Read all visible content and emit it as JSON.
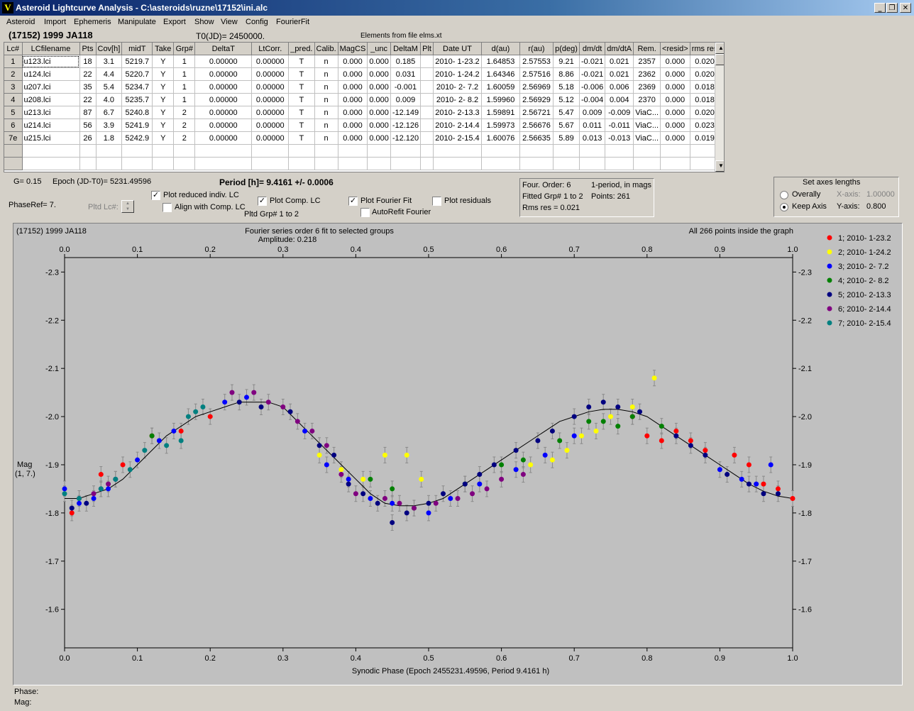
{
  "window": {
    "title": "Asteroid Lightcurve Analysis - C:\\asteroids\\ruzne\\17152\\ini.alc",
    "min": "_",
    "restore": "❐",
    "close": "✕"
  },
  "menu": [
    "Asteroid",
    "Import",
    "Ephemeris",
    "Manipulate",
    "Export",
    "Show",
    "View",
    "Config",
    "FourierFit"
  ],
  "header": {
    "object": "(17152) 1999 JA118",
    "t0": "T0(JD)= 2450000.",
    "elements": "Elements from file elms.xt"
  },
  "table": {
    "columns": [
      "Lc#",
      "LCfilename",
      "Pts",
      "Cov[h]",
      "midT",
      "Take",
      "Grp#",
      "DeltaT",
      "LtCorr.",
      "_pred.",
      "Calib.",
      "MagCS",
      "_unc",
      "DeltaM",
      "Plt",
      "Date UT",
      "d(au)",
      "r(au)",
      "p(deg)",
      "dm/dt",
      "dm/dtA",
      "Rem.",
      "<resid>",
      "rms res"
    ],
    "rows": [
      [
        "1",
        "u123.lci",
        "18",
        "3.1",
        "5219.7",
        "Y",
        "1",
        "0.00000",
        "0.00000",
        "T",
        "n",
        "0.000",
        "0.000",
        "0.185",
        "",
        "2010- 1-23.2",
        "1.64853",
        "2.57553",
        "9.21",
        "-0.021",
        "0.021",
        "2357",
        "0.000",
        "0.020"
      ],
      [
        "2",
        "u124.lci",
        "22",
        "4.4",
        "5220.7",
        "Y",
        "1",
        "0.00000",
        "0.00000",
        "T",
        "n",
        "0.000",
        "0.000",
        "0.031",
        "",
        "2010- 1-24.2",
        "1.64346",
        "2.57516",
        "8.86",
        "-0.021",
        "0.021",
        "2362",
        "0.000",
        "0.020"
      ],
      [
        "3",
        "u207.lci",
        "35",
        "5.4",
        "5234.7",
        "Y",
        "1",
        "0.00000",
        "0.00000",
        "T",
        "n",
        "0.000",
        "0.000",
        "-0.001",
        "",
        "2010- 2- 7.2",
        "1.60059",
        "2.56969",
        "5.18",
        "-0.006",
        "0.006",
        "2369",
        "0.000",
        "0.018"
      ],
      [
        "4",
        "u208.lci",
        "22",
        "4.0",
        "5235.7",
        "Y",
        "1",
        "0.00000",
        "0.00000",
        "T",
        "n",
        "0.000",
        "0.000",
        "0.009",
        "",
        "2010- 2- 8.2",
        "1.59960",
        "2.56929",
        "5.12",
        "-0.004",
        "0.004",
        "2370",
        "0.000",
        "0.018"
      ],
      [
        "5",
        "u213.lci",
        "87",
        "6.7",
        "5240.8",
        "Y",
        "2",
        "0.00000",
        "0.00000",
        "T",
        "n",
        "0.000",
        "0.000",
        "-12.149",
        "",
        "2010- 2-13.3",
        "1.59891",
        "2.56721",
        "5.47",
        "0.009",
        "-0.009",
        "ViaC...",
        "0.000",
        "0.020"
      ],
      [
        "6",
        "u214.lci",
        "56",
        "3.9",
        "5241.9",
        "Y",
        "2",
        "0.00000",
        "0.00000",
        "T",
        "n",
        "0.000",
        "0.000",
        "-12.126",
        "",
        "2010- 2-14.4",
        "1.59973",
        "2.56676",
        "5.67",
        "0.011",
        "-0.011",
        "ViaC...",
        "0.000",
        "0.023"
      ],
      [
        "7e",
        "u215.lci",
        "26",
        "1.8",
        "5242.9",
        "Y",
        "2",
        "0.00000",
        "0.00000",
        "T",
        "n",
        "0.000",
        "0.000",
        "-12.120",
        "",
        "2010- 2-15.4",
        "1.60076",
        "2.56635",
        "5.89",
        "0.013",
        "-0.013",
        "ViaC...",
        "0.000",
        "0.019"
      ]
    ]
  },
  "controls": {
    "g_label": "G= 0.15",
    "epoch": "Epoch (JD-T0)= 5231.49596",
    "period": "Period [h]= 9.4161 +/- 0.0006",
    "phaseref": "PhaseRef= 7.",
    "pltd_lc": "Pltd Lc#:",
    "plot_reduced": "Plot reduced indiv. LC",
    "align_comp": "Align with Comp. LC",
    "plot_comp": "Plot Comp. LC",
    "pltd_grp": "Pltd Grp#  1   to   2",
    "plot_fourier": "Plot Fourier Fit",
    "autorefit": "AutoRefit Fourier",
    "plot_residuals": "Plot residuals",
    "fourier_info": {
      "order": "Four. Order:  6",
      "mode": "1-period, in mags",
      "fitted": "Fitted Grp# 1 to 2",
      "points": "Points: 261",
      "rms": "Rms res     = 0.021"
    },
    "axes_box": {
      "title": "Set axes lengths",
      "overall": "Overally",
      "keep": "Keep Axis",
      "xaxis_label": "X-axis:",
      "xaxis_value": "1.00000",
      "yaxis_label": "Y-axis:",
      "yaxis_value": "0.800"
    }
  },
  "footer": {
    "phase": "Phase:",
    "mag": "Mag:"
  },
  "chart_data": {
    "type": "scatter",
    "title_left": "(17152) 1999 JA118",
    "title_center": "Fourier series order 6 fit to selected groups",
    "subtitle": "Amplitude: 0.218",
    "title_right": "All 266 points inside the graph",
    "xlabel": "Synodic Phase (Epoch 2455231.49596, Period 9.4161 h)",
    "ylabel": "Mag",
    "ylabel2": "(1, 7.)",
    "xlim": [
      0,
      1
    ],
    "ylim": [
      -2.33,
      -1.52
    ],
    "y_reversed": true,
    "x_ticks": [
      "0.0",
      "0.1",
      "0.2",
      "0.3",
      "0.4",
      "0.5",
      "0.6",
      "0.7",
      "0.8",
      "0.9",
      "1.0"
    ],
    "y_ticks": [
      "-2.3",
      "-2.2",
      "-2.1",
      "-2.0",
      "-1.9",
      "-1.8",
      "-1.7",
      "-1.6"
    ],
    "y_tick_values": [
      -2.3,
      -2.2,
      -2.1,
      -2.0,
      -1.9,
      -1.8,
      -1.7,
      -1.6
    ],
    "legend_position": "right",
    "fit_curve": {
      "x": [
        0.0,
        0.02,
        0.04,
        0.06,
        0.08,
        0.1,
        0.12,
        0.14,
        0.16,
        0.18,
        0.2,
        0.22,
        0.24,
        0.26,
        0.28,
        0.3,
        0.32,
        0.34,
        0.36,
        0.38,
        0.4,
        0.42,
        0.44,
        0.46,
        0.48,
        0.5,
        0.52,
        0.54,
        0.56,
        0.58,
        0.6,
        0.62,
        0.64,
        0.66,
        0.68,
        0.7,
        0.72,
        0.74,
        0.76,
        0.78,
        0.8,
        0.82,
        0.84,
        0.86,
        0.88,
        0.9,
        0.92,
        0.94,
        0.96,
        0.98,
        1.0
      ],
      "y": [
        -1.83,
        -1.83,
        -1.84,
        -1.85,
        -1.87,
        -1.9,
        -1.93,
        -1.96,
        -1.98,
        -2.0,
        -2.01,
        -2.02,
        -2.03,
        -2.03,
        -2.03,
        -2.02,
        -1.99,
        -1.96,
        -1.93,
        -1.9,
        -1.87,
        -1.84,
        -1.82,
        -1.815,
        -1.815,
        -1.82,
        -1.83,
        -1.85,
        -1.87,
        -1.89,
        -1.91,
        -1.93,
        -1.95,
        -1.97,
        -1.99,
        -2.0,
        -2.01,
        -2.015,
        -2.015,
        -2.01,
        -2.0,
        -1.98,
        -1.96,
        -1.94,
        -1.92,
        -1.9,
        -1.88,
        -1.86,
        -1.845,
        -1.835,
        -1.83
      ]
    },
    "series": [
      {
        "name": "1; 2010- 1-23.2",
        "color": "#ff0000",
        "x": [
          0.01,
          0.05,
          0.08,
          0.12,
          0.16,
          0.2,
          0.78,
          0.8,
          0.82,
          0.84,
          0.86,
          0.88,
          0.92,
          0.94,
          0.96,
          0.98,
          1.0
        ],
        "y": [
          -1.8,
          -1.88,
          -1.9,
          -1.96,
          -1.97,
          -2.0,
          -2.0,
          -1.96,
          -1.95,
          -1.97,
          -1.95,
          -1.93,
          -1.92,
          -1.9,
          -1.86,
          -1.85,
          -1.83
        ]
      },
      {
        "name": "2; 2010- 1-24.2",
        "color": "#ffff00",
        "x": [
          0.35,
          0.38,
          0.41,
          0.44,
          0.47,
          0.49,
          0.64,
          0.67,
          0.69,
          0.71,
          0.73,
          0.75,
          0.78,
          0.81
        ],
        "y": [
          -1.92,
          -1.89,
          -1.87,
          -1.92,
          -1.92,
          -1.87,
          -1.9,
          -1.91,
          -1.93,
          -1.96,
          -1.97,
          -2.0,
          -2.02,
          -2.08
        ]
      },
      {
        "name": "3; 2010- 2- 7.2",
        "color": "#0000ff",
        "x": [
          0.0,
          0.02,
          0.04,
          0.06,
          0.1,
          0.13,
          0.15,
          0.22,
          0.25,
          0.33,
          0.36,
          0.39,
          0.42,
          0.45,
          0.5,
          0.53,
          0.57,
          0.62,
          0.66,
          0.7,
          0.9,
          0.93,
          0.95,
          0.97
        ],
        "y": [
          -1.85,
          -1.82,
          -1.83,
          -1.85,
          -1.91,
          -1.95,
          -1.97,
          -2.03,
          -2.04,
          -1.97,
          -1.9,
          -1.87,
          -1.83,
          -1.82,
          -1.8,
          -1.83,
          -1.86,
          -1.89,
          -1.92,
          -1.96,
          -1.89,
          -1.87,
          -1.86,
          -1.9
        ]
      },
      {
        "name": "4; 2010- 2- 8.2",
        "color": "#008000",
        "x": [
          0.12,
          0.42,
          0.45,
          0.48,
          0.55,
          0.6,
          0.63,
          0.68,
          0.72,
          0.74,
          0.76,
          0.78,
          0.82
        ],
        "y": [
          -1.96,
          -1.87,
          -1.85,
          -1.81,
          -1.86,
          -1.9,
          -1.91,
          -1.95,
          -1.99,
          -1.99,
          -1.98,
          -2.0,
          -1.98
        ]
      },
      {
        "name": "5; 2010- 2-13.3",
        "color": "#000080",
        "x": [
          0.01,
          0.03,
          0.05,
          0.07,
          0.24,
          0.27,
          0.31,
          0.35,
          0.37,
          0.39,
          0.41,
          0.43,
          0.45,
          0.47,
          0.5,
          0.52,
          0.55,
          0.57,
          0.59,
          0.62,
          0.65,
          0.67,
          0.7,
          0.72,
          0.74,
          0.76,
          0.79,
          0.84,
          0.86,
          0.88,
          0.91,
          0.94,
          0.96,
          0.98
        ],
        "y": [
          -1.81,
          -1.82,
          -1.85,
          -1.87,
          -2.03,
          -2.02,
          -2.01,
          -1.94,
          -1.92,
          -1.86,
          -1.84,
          -1.82,
          -1.78,
          -1.8,
          -1.82,
          -1.84,
          -1.86,
          -1.88,
          -1.9,
          -1.93,
          -1.95,
          -1.97,
          -2.0,
          -2.02,
          -2.03,
          -2.02,
          -2.01,
          -1.96,
          -1.94,
          -1.92,
          -1.88,
          -1.86,
          -1.84,
          -1.84
        ]
      },
      {
        "name": "6; 2010- 2-14.4",
        "color": "#800080",
        "x": [
          0.02,
          0.04,
          0.06,
          0.23,
          0.26,
          0.28,
          0.3,
          0.32,
          0.34,
          0.36,
          0.38,
          0.4,
          0.44,
          0.46,
          0.48,
          0.51,
          0.54,
          0.56,
          0.58,
          0.6,
          0.63
        ],
        "y": [
          -1.83,
          -1.84,
          -1.86,
          -2.05,
          -2.05,
          -2.03,
          -2.02,
          -1.99,
          -1.97,
          -1.94,
          -1.88,
          -1.84,
          -1.83,
          -1.82,
          -1.81,
          -1.82,
          -1.83,
          -1.84,
          -1.85,
          -1.87,
          -1.88
        ]
      },
      {
        "name": "7; 2010- 2-15.4",
        "color": "#008080",
        "x": [
          0.0,
          0.02,
          0.05,
          0.07,
          0.09,
          0.11,
          0.14,
          0.16,
          0.17,
          0.18,
          0.19
        ],
        "y": [
          -1.84,
          -1.83,
          -1.85,
          -1.87,
          -1.89,
          -1.93,
          -1.94,
          -1.95,
          -2.0,
          -2.01,
          -2.02
        ]
      }
    ]
  }
}
